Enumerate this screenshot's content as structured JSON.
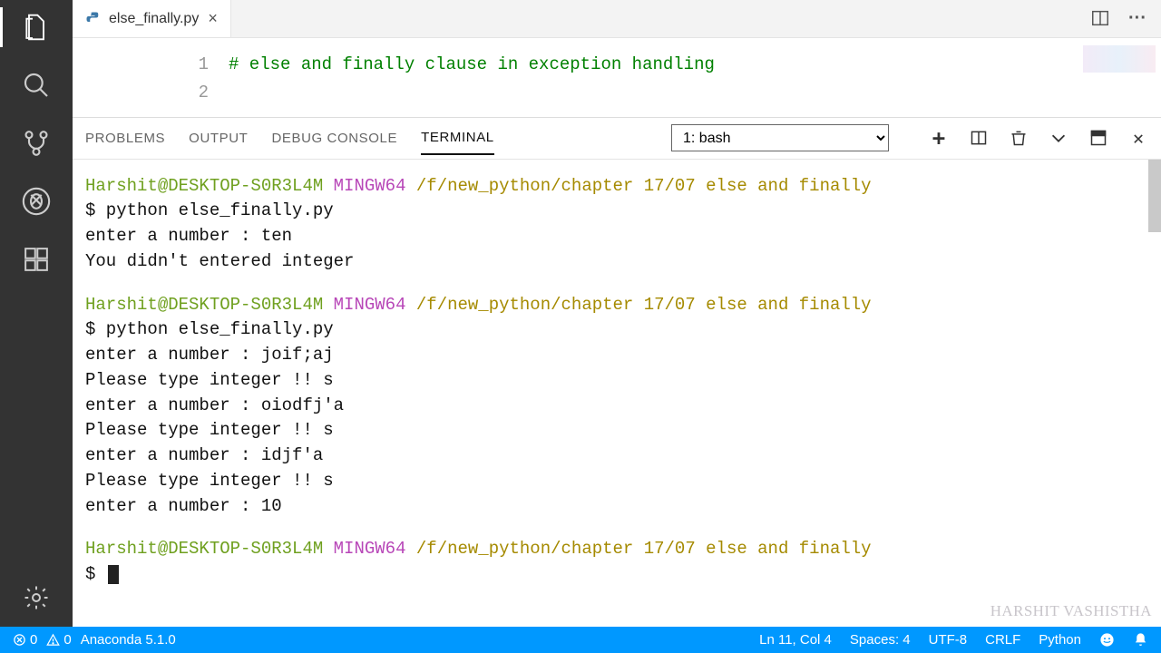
{
  "tabs": {
    "file": {
      "name": "else_finally.py"
    }
  },
  "editor": {
    "lineNumbers": [
      "1",
      "2"
    ],
    "line1Comment": "# else and finally clause in exception handling"
  },
  "panel": {
    "tabs": {
      "problems": "PROBLEMS",
      "output": "OUTPUT",
      "debug": "DEBUG CONSOLE",
      "terminal": "TERMINAL"
    },
    "selector": "1: bash"
  },
  "terminal": {
    "prompts": [
      {
        "user": "Harshit@DESKTOP-S0R3L4M",
        "mingw": "MINGW64",
        "path": "/f/new_python/chapter 17/07 else and finally"
      }
    ],
    "cmd": "$ python else_finally.py",
    "run1": [
      "enter a number : ten",
      "You didn't entered integer"
    ],
    "run2": [
      "enter a number : joif;aj",
      "Please type integer !! s",
      "enter a number : oiodfj'a",
      "Please type integer !! s",
      "enter a number : idjf'a",
      "Please type integer !! s",
      "enter a number : 10"
    ],
    "dollar": "$ "
  },
  "statusBar": {
    "errors": "0",
    "warnings": "0",
    "env": "Anaconda 5.1.0",
    "lncol": "Ln 11, Col 4",
    "spaces": "Spaces: 4",
    "encoding": "UTF-8",
    "eol": "CRLF",
    "lang": "Python"
  },
  "watermark": "HARSHIT VASHISTHA"
}
